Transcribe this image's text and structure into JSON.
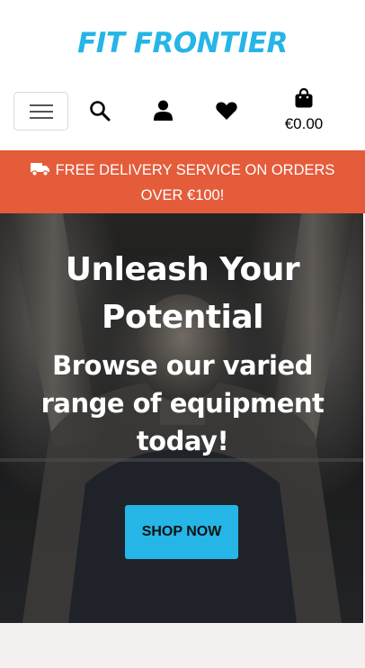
{
  "header": {
    "brand": "FIT FRONTIER",
    "icons": [
      "menu-icon",
      "search-icon",
      "user-icon",
      "heart-icon",
      "shopping-bag-icon"
    ],
    "cart_total": "€0.00"
  },
  "banner": {
    "icon": "truck-icon",
    "line1": "FREE DELIVERY SERVICE ON ORDERS",
    "line2": "OVER €100!"
  },
  "hero": {
    "title_line1": "Unleash Your",
    "title_line2": "Potential",
    "subtitle_line1": "Browse our varied",
    "subtitle_line2": "range of equipment",
    "subtitle_line3": "today!",
    "cta_label": "SHOP NOW"
  },
  "colors": {
    "brand": "#25b5e6",
    "banner": "#e45c3a",
    "cta": "#25b5e6",
    "footer_strip": "#f5f0f0"
  }
}
